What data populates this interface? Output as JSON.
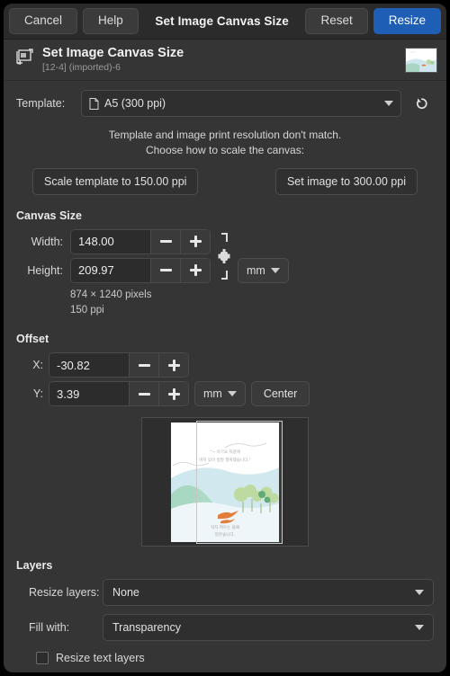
{
  "titlebar": {
    "cancel": "Cancel",
    "help": "Help",
    "title": "Set Image Canvas Size",
    "reset": "Reset",
    "resize": "Resize",
    "accent_color": "#1f5eb5"
  },
  "subheader": {
    "title": "Set Image Canvas Size",
    "subtitle": "[12-4] (imported)-6",
    "icon": "canvas-resize-icon",
    "thumbnail": "image-thumbnail"
  },
  "template": {
    "label": "Template:",
    "value": "A5 (300 ppi)",
    "value_icon": "document-icon",
    "reset_icon": "reset-arrow-icon",
    "notice_line1": "Template and image print resolution don't match.",
    "notice_line2": "Choose how to scale the canvas:",
    "scale_template_button": "Scale template to 150.00 ppi",
    "set_image_button": "Set image to 300.00 ppi"
  },
  "canvas_size": {
    "section_title": "Canvas Size",
    "width_label": "Width:",
    "width_value": "148.00",
    "height_label": "Height:",
    "height_value": "209.97",
    "chain_icon": "chain-broken-icon",
    "unit": "mm",
    "pixels_text": "874 × 1240 pixels",
    "ppi_text": "150 ppi",
    "minus_icon": "minus-icon",
    "plus_icon": "plus-icon"
  },
  "offset": {
    "section_title": "Offset",
    "x_label": "X:",
    "x_value": "-30.82",
    "y_label": "Y:",
    "y_value": "3.39",
    "unit": "mm",
    "center_button": "Center"
  },
  "preview": {
    "name": "canvas-offset-preview",
    "caption_top": "\"~ 아기요 저같에\n여지 있어 정말 행복했습니다.\"",
    "caption_bottom": "익자 여우는 울때\n말문습니다."
  },
  "layers": {
    "section_title": "Layers",
    "resize_layers_label": "Resize layers:",
    "resize_layers_value": "None",
    "fill_with_label": "Fill with:",
    "fill_with_value": "Transparency",
    "resize_text_layers_label": "Resize text layers",
    "resize_text_layers_checked": false
  }
}
